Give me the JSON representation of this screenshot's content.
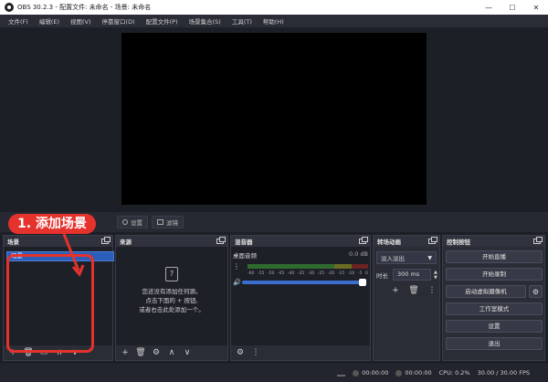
{
  "window": {
    "title": "OBS 30.2.3 - 配置文件: 未命名 - 场景: 未命名",
    "controls": [
      "—",
      "☐",
      "✕"
    ]
  },
  "menu": [
    "文件(F)",
    "编辑(E)",
    "视图(V)",
    "停靠窗口(D)",
    "配置文件(P)",
    "场景集合(S)",
    "工具(T)",
    "帮助(H)"
  ],
  "toolbar": {
    "properties_label": "设置",
    "filters_label": "滤镜"
  },
  "annotation": {
    "label": "1. 添加场景",
    "color": "#e5322d"
  },
  "docks": {
    "scenes": {
      "title": "场景",
      "items": [
        "场景"
      ]
    },
    "sources": {
      "title": "来源",
      "empty_lines": [
        "您还没有添加任何源。",
        "点击下面的 + 按钮,",
        "或者右击此处添加一个。"
      ]
    },
    "mixer": {
      "title": "混音器",
      "track_name": "桌面音频",
      "db": "0.0 dB",
      "ticks": [
        "-60",
        "-55",
        "-50",
        "-45",
        "-40",
        "-35",
        "-30",
        "-25",
        "-20",
        "-15",
        "-10",
        "-5",
        "0"
      ]
    },
    "transitions": {
      "title": "转场动画",
      "selected": "淡入淡出",
      "duration_label": "时长",
      "duration_value": "300 ms"
    },
    "controls": {
      "title": "控制按钮",
      "buttons": [
        "开始直播",
        "开始录制",
        "启动虚拟摄像机",
        "工作室模式",
        "设置",
        "退出"
      ]
    }
  },
  "status": {
    "stream_time": "00:00:00",
    "record_time": "00:00:00",
    "cpu": "CPU: 0.2%",
    "fps": "30.00 / 30.00 FPS"
  },
  "colors": {
    "accent": "#2b5eb8",
    "background": "#1d1f26"
  }
}
